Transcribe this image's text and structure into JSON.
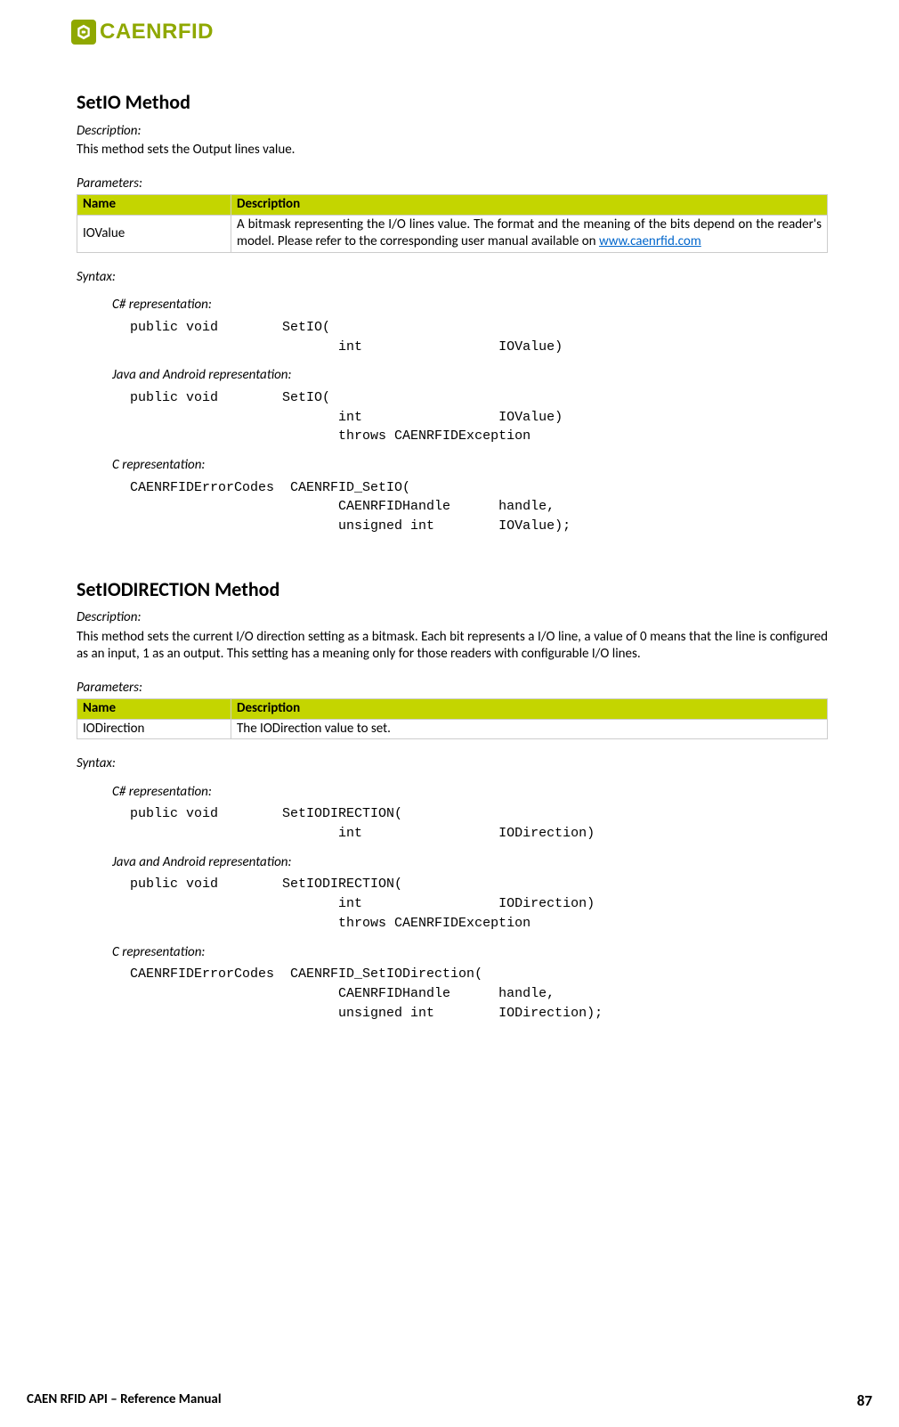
{
  "logo": {
    "text": "CAENRFID"
  },
  "method1": {
    "title": "SetIO Method",
    "desc_label": "Description:",
    "desc_text": "This method sets the Output lines value.",
    "params_label": "Parameters:",
    "table": {
      "h_name": "Name",
      "h_desc": "Description",
      "r1_name": "IOValue",
      "r1_desc_pre": "A bitmask representing the I/O lines value. The format and the meaning of the bits depend on the reader's model. Please refer to the corresponding user manual available on ",
      "r1_link": "www.caenrfid.com"
    },
    "syntax_label": "Syntax:",
    "csharp_label": "C# representation:",
    "csharp_code": "public void        SetIO(\n                          int                 IOValue)",
    "java_label": "Java and Android representation:",
    "java_code": "public void        SetIO(\n                          int                 IOValue)\n                          throws CAENRFIDException",
    "c_label": "C representation:",
    "c_code": "CAENRFIDErrorCodes  CAENRFID_SetIO(\n                          CAENRFIDHandle      handle,\n                          unsigned int        IOValue);"
  },
  "method2": {
    "title": "SetIODIRECTION Method",
    "desc_label": "Description:",
    "desc_text": "This method sets the current I/O direction setting as a bitmask. Each bit represents a I/O line, a value of 0 means that the line is configured as an input, 1 as an output. This setting has a meaning only for those readers with configurable I/O lines.",
    "params_label": "Parameters:",
    "table": {
      "h_name": "Name",
      "h_desc": "Description",
      "r1_name": "IODirection",
      "r1_desc": "The IODirection value to set."
    },
    "syntax_label": "Syntax:",
    "csharp_label": "C# representation:",
    "csharp_code": "public void        SetIODIRECTION(\n                          int                 IODirection)",
    "java_label": "Java and Android representation:",
    "java_code": "public void        SetIODIRECTION(\n                          int                 IODirection)\n                          throws CAENRFIDException",
    "c_label": "C representation:",
    "c_code": "CAENRFIDErrorCodes  CAENRFID_SetIODirection(\n                          CAENRFIDHandle      handle,\n                          unsigned int        IODirection);"
  },
  "footer": {
    "left": "CAEN RFID API – Reference Manual",
    "page": "87"
  }
}
